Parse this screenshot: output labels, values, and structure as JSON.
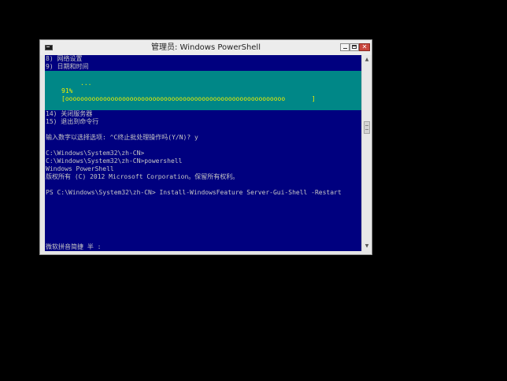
{
  "window": {
    "title": "管理员: Windows PowerShell",
    "controls": {
      "minimize_icon": "minimize-icon",
      "maximize_icon": "maximize-icon",
      "close_icon": "close-icon",
      "close_glyph": "✕"
    }
  },
  "console": {
    "menu_top": [
      "8) 网络设置",
      "9) 日期和时间"
    ],
    "progress": {
      "dots": "...",
      "percent": "91%",
      "bar": "[oooooooooooooooooooooooooooooooooooooooooooooooooooooooooo       ]",
      "color": "#f0f000",
      "background": "#008787"
    },
    "menu_bottom": [
      "14) 关闭服务器",
      "15) 退出到命令行"
    ],
    "prompt_line": "输入数字以选择选项: ^C终止批处理操作吗(Y/N)? y",
    "session_lines": [
      "C:\\Windows\\System32\\zh-CN>",
      "C:\\Windows\\System32\\zh-CN>powershell",
      "Windows PowerShell",
      "版权所有 (C) 2012 Microsoft Corporation。保留所有权利。"
    ],
    "ps_command": "PS C:\\Windows\\System32\\zh-CN> Install-WindowsFeature Server-Gui-Shell -Restart",
    "ime_status": "微软拼音简捷 半 :",
    "background": "#00007f",
    "text_color": "#c6c6c6"
  },
  "scrollbar": {
    "up_glyph": "▲",
    "down_glyph": "▼"
  }
}
